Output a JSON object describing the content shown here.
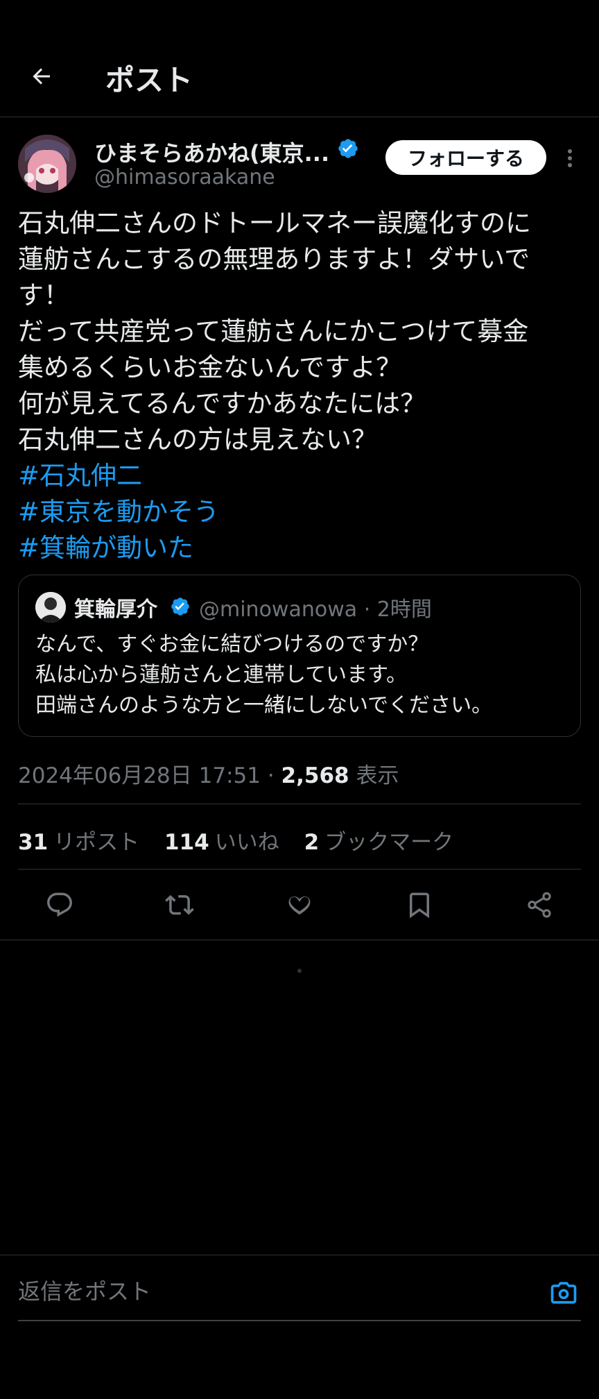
{
  "header": {
    "title": "ポスト"
  },
  "author": {
    "display_name": "ひまそらあかね(東京...",
    "handle": "@himasoraakane",
    "follow_label": "フォローする"
  },
  "tweet": {
    "lines": [
      "石丸伸二さんのドトールマネー誤魔化すのに",
      "蓮舫さんこするの無理ありますよ！ダサいで",
      "す！",
      "だって共産党って蓮舫さんにかこつけて募金",
      "集めるくらいお金ないんですよ？",
      "何が見えてるんですかあなたには？",
      "石丸伸二さんの方は見えない？"
    ],
    "hashtags": [
      "#石丸伸二",
      "#東京を動かそう",
      "#箕輪が動いた"
    ]
  },
  "quote": {
    "display_name": "箕輪厚介",
    "handle": "@minowanowa",
    "time": "· 2時間",
    "lines": [
      "なんで、すぐお金に結びつけるのですか？",
      "私は心から蓮舫さんと連帯しています。",
      "田端さんのような方と一緒にしないでください。"
    ]
  },
  "meta": {
    "datetime": "2024年06月28日 17:51 · ",
    "views": "2,568",
    "views_label": " 表示"
  },
  "stats": {
    "reposts": "31",
    "reposts_label": "リポスト",
    "likes": "114",
    "likes_label": "いいね",
    "bookmarks": "2",
    "bookmarks_label": "ブックマーク"
  },
  "reply": {
    "placeholder": "返信をポスト"
  },
  "colors": {
    "background": "#000000",
    "accent": "#1d9bf0",
    "muted": "#71767b",
    "text": "#e7e9ea"
  }
}
